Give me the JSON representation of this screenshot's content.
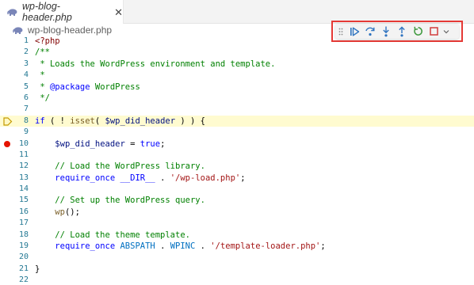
{
  "tab": {
    "title": "wp-blog-header.php",
    "close_glyph": "✕",
    "icon": "php-elephant-icon"
  },
  "breadcrumb": {
    "file": "wp-blog-header.php"
  },
  "debug_toolbar": {
    "buttons": [
      "drag-grip-icon",
      "continue-icon",
      "step-over-icon",
      "step-into-icon",
      "step-out-icon",
      "restart-icon",
      "stop-icon",
      "chevron-down-icon"
    ],
    "colors": {
      "continue": "#2f74c0",
      "restart": "#3f9a3f",
      "stop": "#d13c3c"
    }
  },
  "editor": {
    "breakpoint_line": 10,
    "stopped_line": 8,
    "lines": [
      {
        "n": "1",
        "code": "<?php"
      },
      {
        "n": "2",
        "code": "/**"
      },
      {
        "n": "3",
        "code": " * Loads the WordPress environment and template."
      },
      {
        "n": "4",
        "code": " *"
      },
      {
        "n": "5",
        "code": " * @package WordPress"
      },
      {
        "n": "6",
        "code": " */"
      },
      {
        "n": "7",
        "code": ""
      },
      {
        "n": "8",
        "code": "if ( ! isset( $wp_did_header ) ) {"
      },
      {
        "n": "9",
        "code": ""
      },
      {
        "n": "10",
        "code": "    $wp_did_header = true;"
      },
      {
        "n": "11",
        "code": ""
      },
      {
        "n": "12",
        "code": "    // Load the WordPress library."
      },
      {
        "n": "13",
        "code": "    require_once __DIR__ . '/wp-load.php';"
      },
      {
        "n": "14",
        "code": ""
      },
      {
        "n": "15",
        "code": "    // Set up the WordPress query."
      },
      {
        "n": "16",
        "code": "    wp();"
      },
      {
        "n": "17",
        "code": ""
      },
      {
        "n": "18",
        "code": "    // Load the theme template."
      },
      {
        "n": "19",
        "code": "    require_once ABSPATH . WPINC . '/template-loader.php';"
      },
      {
        "n": "20",
        "code": ""
      },
      {
        "n": "21",
        "code": "}"
      },
      {
        "n": "22",
        "code": ""
      }
    ]
  }
}
